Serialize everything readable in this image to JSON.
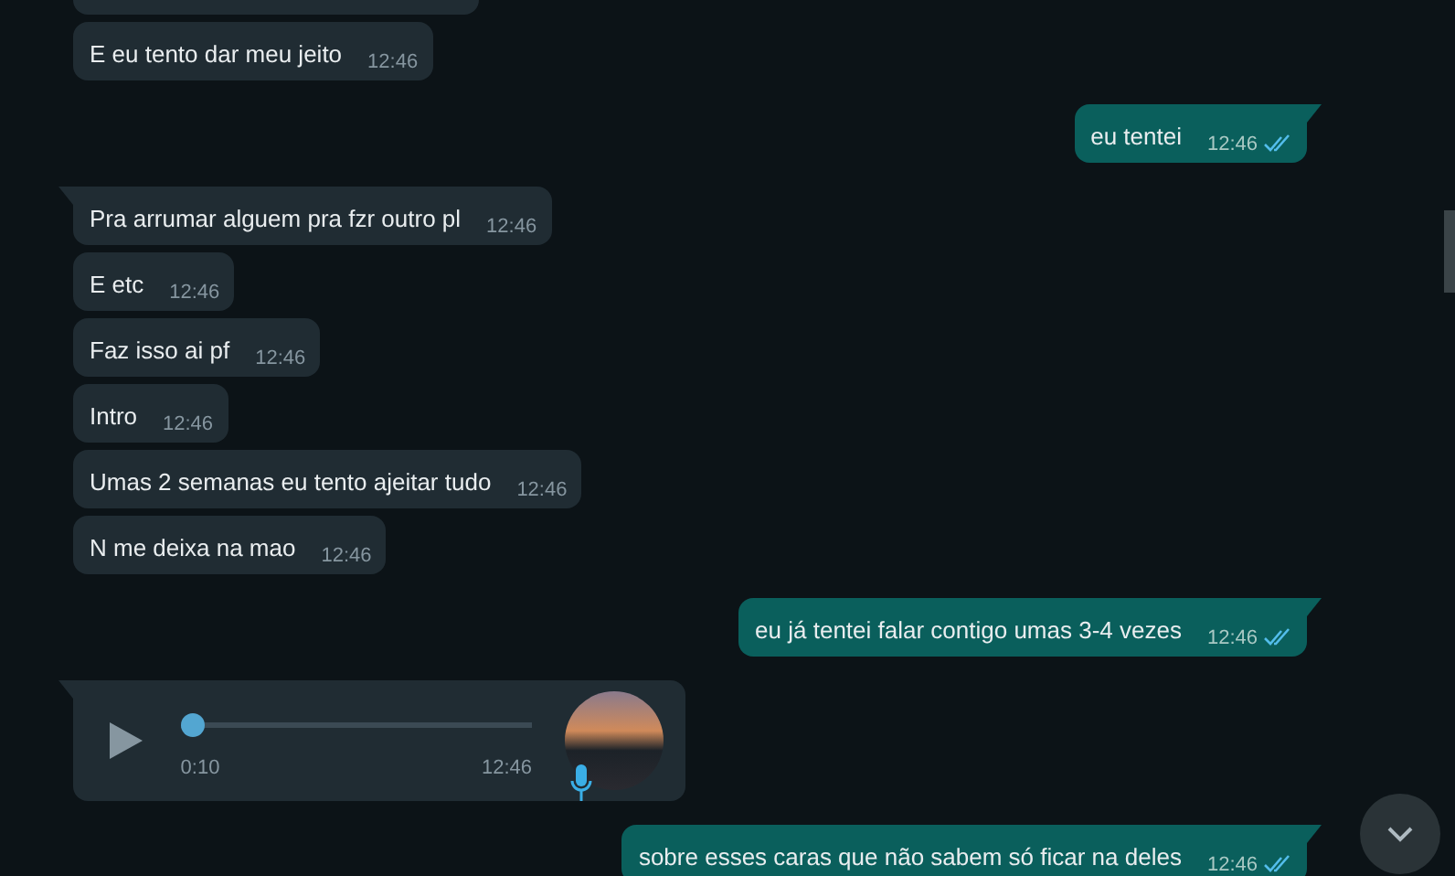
{
  "messages": [
    {
      "kind": "partial",
      "outgoing": false,
      "tail": false
    },
    {
      "kind": "text",
      "outgoing": false,
      "tail": false,
      "text": "E eu tento dar meu jeito",
      "time": "12:46"
    },
    {
      "kind": "text",
      "outgoing": true,
      "tail": true,
      "text": "eu tentei",
      "time": "12:46",
      "read": true
    },
    {
      "kind": "text",
      "outgoing": false,
      "tail": true,
      "text": "Pra arrumar alguem pra fzr outro pl",
      "time": "12:46"
    },
    {
      "kind": "text",
      "outgoing": false,
      "tail": false,
      "text": "E etc",
      "time": "12:46"
    },
    {
      "kind": "text",
      "outgoing": false,
      "tail": false,
      "text": "Faz isso ai pf",
      "time": "12:46"
    },
    {
      "kind": "text",
      "outgoing": false,
      "tail": false,
      "text": "Intro",
      "time": "12:46"
    },
    {
      "kind": "text",
      "outgoing": false,
      "tail": false,
      "text": "Umas 2 semanas eu tento ajeitar tudo",
      "time": "12:46"
    },
    {
      "kind": "text",
      "outgoing": false,
      "tail": false,
      "text": "N me deixa na mao",
      "time": "12:46"
    },
    {
      "kind": "text",
      "outgoing": true,
      "tail": true,
      "text": "eu já tentei falar contigo umas 3-4 vezes",
      "time": "12:46",
      "read": true
    },
    {
      "kind": "voice",
      "outgoing": false,
      "tail": true,
      "duration": "0:10",
      "time": "12:46",
      "level": 0
    },
    {
      "kind": "text",
      "outgoing": true,
      "tail": true,
      "text": "sobre esses caras que não sabem só ficar na deles",
      "time": "12:46",
      "read": true
    }
  ]
}
